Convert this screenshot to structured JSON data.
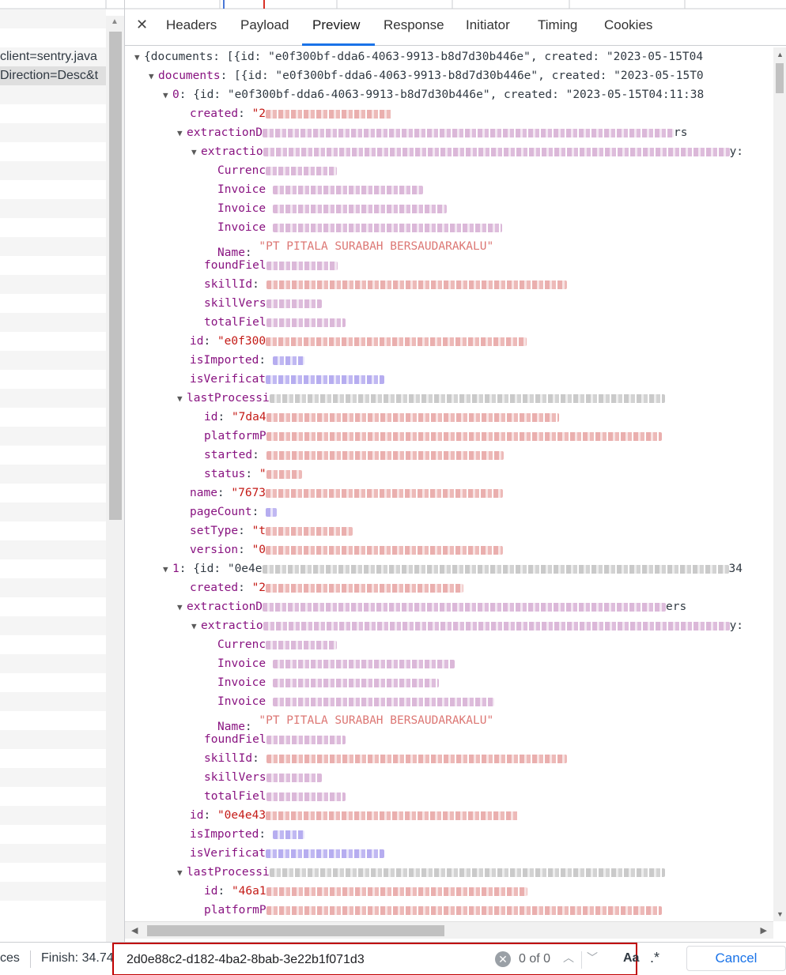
{
  "left_list": {
    "rows": [
      "",
      "",
      "",
      "client=sentry.java",
      "Direction=Desc&t",
      "",
      "",
      "",
      "",
      "",
      "",
      "",
      "",
      "",
      "",
      "",
      "",
      "",
      "",
      "",
      "",
      "",
      "",
      "",
      "",
      "",
      "",
      "",
      "",
      "",
      "",
      "",
      "",
      "",
      "",
      "",
      "",
      "",
      "",
      "",
      "",
      "",
      "",
      "",
      "",
      "",
      "",
      "",
      ""
    ]
  },
  "tabs": [
    {
      "label": "Headers"
    },
    {
      "label": "Payload"
    },
    {
      "label": "Preview",
      "active": true
    },
    {
      "label": "Response"
    },
    {
      "label": "Initiator"
    },
    {
      "label": "Timing"
    },
    {
      "label": "Cookies"
    }
  ],
  "preview": {
    "l0": "{documents: [{id: \"e0f300bf-dda6-4063-9913-b8d7d30b446e\", created: \"2023-05-15T04",
    "l1_key": "documents",
    "l1_rest": ": [{id: \"e0f300bf-dda6-4063-9913-b8d7d30b446e\", created: \"2023-05-15T0",
    "l2_key": "0",
    "l2_rest": ": {id: \"e0f300bf-dda6-4063-9913-b8d7d30b446e\", created: \"2023-05-15T04:11:38",
    "created_key": "created",
    "created_val": "\"2",
    "extractionData_key": "extractionD",
    "extractionData_tail": "rs",
    "extractionKeyFields_key": "extractio",
    "extractionKeyFields_tail": "y:",
    "currency_key": "Currenc",
    "invoice_date_key": "Invoice",
    "invoice_number_key": "Invoice",
    "invoice_total_key": "Invoice",
    "name_key": "Name",
    "name_val": "\"PT PITALA SURABAH BERSAUDARAKALU\"",
    "foundFieldCount_key": "foundFiel",
    "skillId_key": "skillId",
    "skillVersion_key": "skillVers",
    "totalFieldCount_key": "totalFiel",
    "id_key": "id",
    "id_val": "\"e0f300",
    "isImported_key": "isImported",
    "isVerification_key": "isVerificat",
    "lastProcessing_key": "lastProcessi",
    "lp_id_key": "id",
    "lp_id_val": "\"7da4",
    "lp_platform_key": "platformP",
    "lp_started_key": "started",
    "lp_status_key": "status",
    "lp_status_val": "\"",
    "name2_key": "name",
    "name2_val": "\"7673",
    "pageCount_key": "pageCount",
    "setType_key": "setType",
    "setType_val": "\"t",
    "version_key": "version",
    "version_val": "\"0",
    "item1_key": "1",
    "item1_rest": ": {id: \"0e4e",
    "item1_tail": "34",
    "created2_val": "\"2",
    "extractionData2_tail": "ers",
    "extractionKeyFields2_tail": "y:",
    "name3_val": "\"PT PITALA SURABAH BERSAUDARAKALU\"",
    "id2_val": "\"0e4e43",
    "isImported2_val": "",
    "lp2_id_val": "\"46a1"
  },
  "status_bar": {
    "requests_partial": "ces",
    "finish": "Finish: 34.74"
  },
  "search": {
    "value": "2d0e88c2-d182-4ba2-8bab-3e22b1f071d3",
    "match_count": "0 of 0",
    "case_label": "Aa",
    "regex_label": ".*",
    "cancel_label": "Cancel"
  },
  "colors": {
    "key": "#881280",
    "string": "#c41a16",
    "accent": "#1a73e8",
    "highlight_border": "#c00000"
  }
}
